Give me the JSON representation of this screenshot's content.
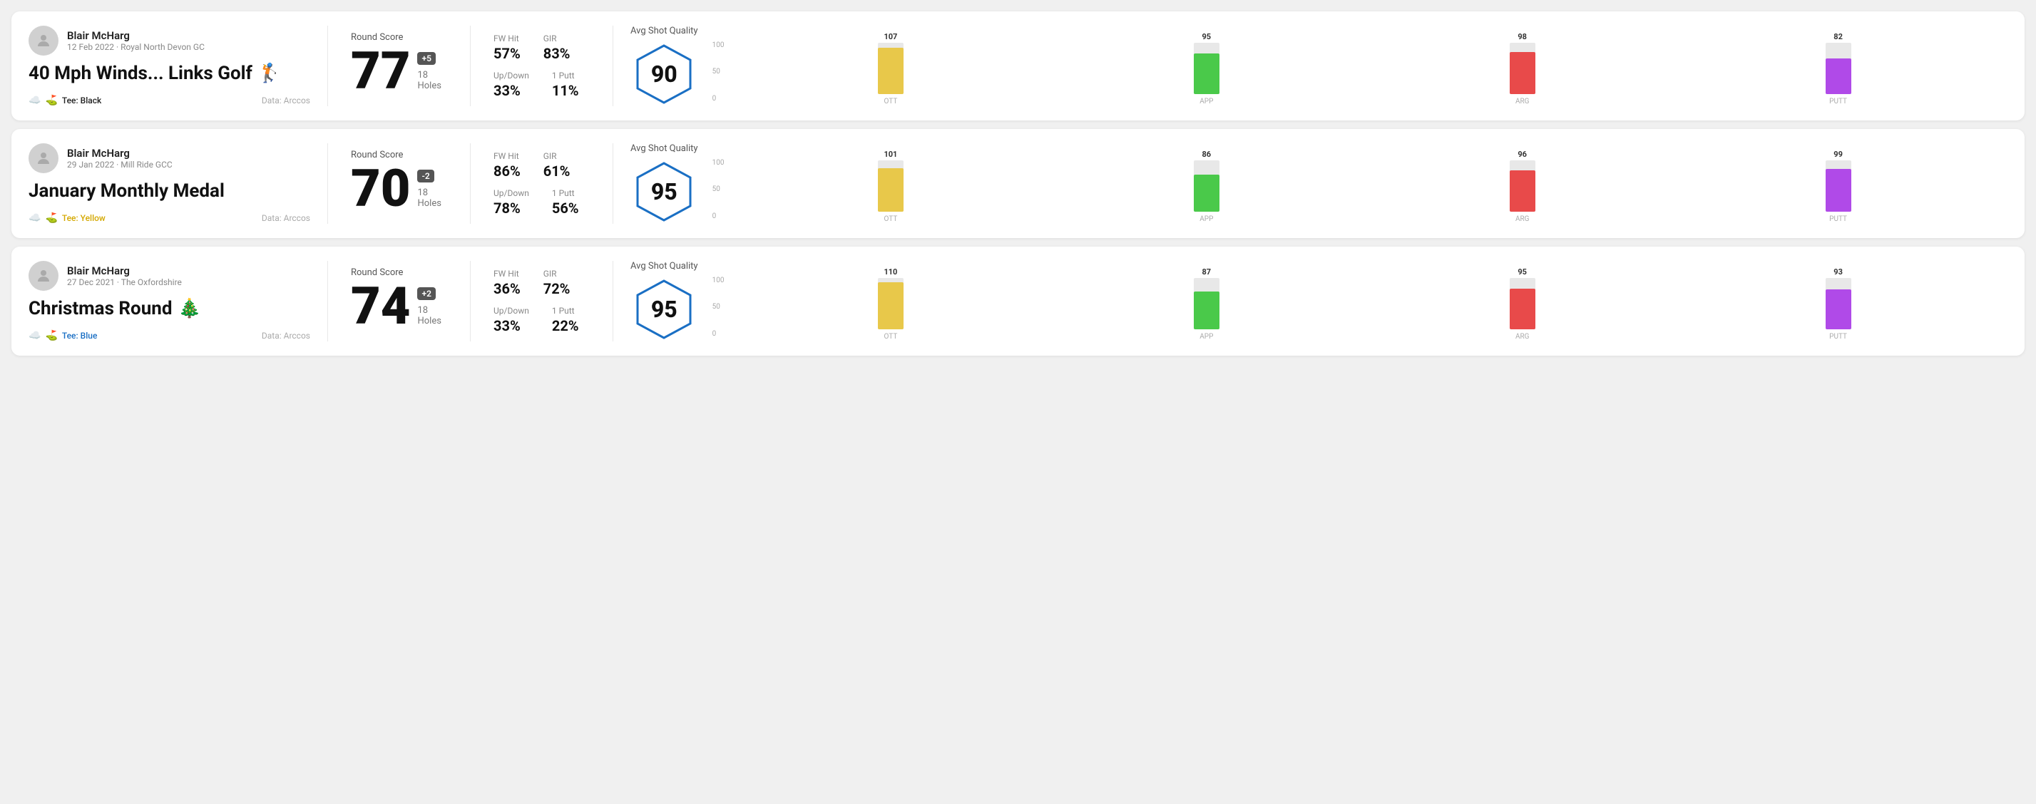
{
  "rounds": [
    {
      "id": "round1",
      "user": {
        "name": "Blair McHarg",
        "meta": "12 Feb 2022 · Royal North Devon GC"
      },
      "title": "40 Mph Winds... Links Golf",
      "title_emoji": "🏌️",
      "tee": "Black",
      "data_source": "Data: Arccos",
      "score": "77",
      "score_diff": "+5",
      "holes": "18 Holes",
      "fw_hit": "57%",
      "gir": "83%",
      "up_down": "33%",
      "one_putt": "11%",
      "avg_quality": "90",
      "chart": {
        "bars": [
          {
            "label": "OTT",
            "value": 107,
            "color": "#e8c84a"
          },
          {
            "label": "APP",
            "value": 95,
            "color": "#4ac94a"
          },
          {
            "label": "ARG",
            "value": 98,
            "color": "#e84a4a"
          },
          {
            "label": "PUTT",
            "value": 82,
            "color": "#b04ae8"
          }
        ],
        "max": 120
      }
    },
    {
      "id": "round2",
      "user": {
        "name": "Blair McHarg",
        "meta": "29 Jan 2022 · Mill Ride GCC"
      },
      "title": "January Monthly Medal",
      "title_emoji": "",
      "tee": "Yellow",
      "data_source": "Data: Arccos",
      "score": "70",
      "score_diff": "-2",
      "holes": "18 Holes",
      "fw_hit": "86%",
      "gir": "61%",
      "up_down": "78%",
      "one_putt": "56%",
      "avg_quality": "95",
      "chart": {
        "bars": [
          {
            "label": "OTT",
            "value": 101,
            "color": "#e8c84a"
          },
          {
            "label": "APP",
            "value": 86,
            "color": "#4ac94a"
          },
          {
            "label": "ARG",
            "value": 96,
            "color": "#e84a4a"
          },
          {
            "label": "PUTT",
            "value": 99,
            "color": "#b04ae8"
          }
        ],
        "max": 120
      }
    },
    {
      "id": "round3",
      "user": {
        "name": "Blair McHarg",
        "meta": "27 Dec 2021 · The Oxfordshire"
      },
      "title": "Christmas Round",
      "title_emoji": "🎄",
      "tee": "Blue",
      "data_source": "Data: Arccos",
      "score": "74",
      "score_diff": "+2",
      "holes": "18 Holes",
      "fw_hit": "36%",
      "gir": "72%",
      "up_down": "33%",
      "one_putt": "22%",
      "avg_quality": "95",
      "chart": {
        "bars": [
          {
            "label": "OTT",
            "value": 110,
            "color": "#e8c84a"
          },
          {
            "label": "APP",
            "value": 87,
            "color": "#4ac94a"
          },
          {
            "label": "ARG",
            "value": 95,
            "color": "#e84a4a"
          },
          {
            "label": "PUTT",
            "value": 93,
            "color": "#b04ae8"
          }
        ],
        "max": 120
      }
    }
  ],
  "labels": {
    "round_score": "Round Score",
    "fw_hit": "FW Hit",
    "gir": "GIR",
    "up_down": "Up/Down",
    "one_putt": "1 Putt",
    "avg_quality": "Avg Shot Quality",
    "y_100": "100",
    "y_50": "50",
    "y_0": "0"
  }
}
